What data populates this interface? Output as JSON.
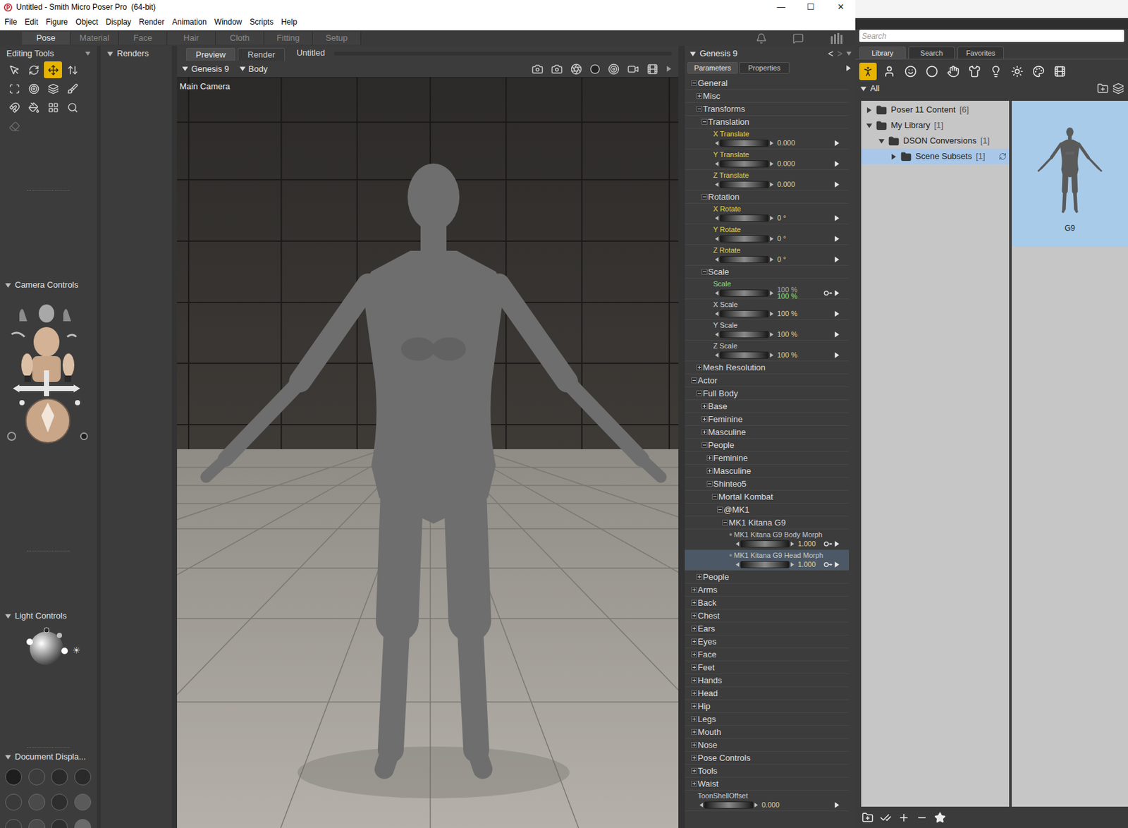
{
  "window": {
    "title": "Untitled - Smith Micro Poser Pro  (64-bit)",
    "controls": [
      "—",
      "☐",
      "✕"
    ]
  },
  "menu": [
    "File",
    "Edit",
    "Figure",
    "Object",
    "Display",
    "Render",
    "Animation",
    "Window",
    "Scripts",
    "Help"
  ],
  "rooms": [
    {
      "label": "Pose",
      "selected": true
    },
    {
      "label": "Material",
      "selected": false
    },
    {
      "label": "Face",
      "selected": false
    },
    {
      "label": "Hair",
      "selected": false
    },
    {
      "label": "Cloth",
      "selected": false
    },
    {
      "label": "Fitting",
      "selected": false
    },
    {
      "label": "Setup",
      "selected": false
    }
  ],
  "editing_tools": {
    "title": "Editing Tools",
    "tools": [
      {
        "selected": false,
        "disabled": false
      },
      {
        "selected": false,
        "disabled": false
      },
      {
        "selected": true,
        "disabled": false
      },
      {
        "selected": false,
        "disabled": false
      },
      {
        "selected": false,
        "disabled": false
      },
      {
        "selected": false,
        "disabled": false
      },
      {
        "selected": false,
        "disabled": false
      },
      {
        "selected": false,
        "disabled": false
      },
      {
        "selected": false,
        "disabled": false
      },
      {
        "selected": false,
        "disabled": false
      },
      {
        "selected": false,
        "disabled": false
      },
      {
        "selected": false,
        "disabled": false
      },
      {
        "selected": false,
        "disabled": true
      }
    ]
  },
  "camera_controls": {
    "title": "Camera Controls"
  },
  "light_controls": {
    "title": "Light Controls"
  },
  "document_display": {
    "title": "Document Displa..."
  },
  "renders": {
    "title": "Renders"
  },
  "viewport": {
    "tabs": [
      {
        "label": "Preview",
        "selected": true
      },
      {
        "label": "Render",
        "selected": false
      }
    ],
    "document": "Untitled",
    "figure": "Genesis 9",
    "actor": "Body",
    "camera": "Main Camera"
  },
  "parameters": {
    "figure": "Genesis 9",
    "nav": [
      "<",
      ">"
    ],
    "tabs": [
      {
        "label": "Parameters",
        "selected": true
      },
      {
        "label": "Properties",
        "selected": false
      }
    ],
    "rows": [
      {
        "kind": "group",
        "label": "General",
        "depth": 0,
        "expanded": true
      },
      {
        "kind": "group",
        "label": "Misc",
        "depth": 1,
        "expanded": false
      },
      {
        "kind": "group",
        "label": "Transforms",
        "depth": 1,
        "expanded": true
      },
      {
        "kind": "group",
        "label": "Translation",
        "depth": 2,
        "expanded": true
      },
      {
        "kind": "dial",
        "label": "X Translate",
        "depth": 3,
        "values": [
          "0.000"
        ],
        "color": "#e6d34a",
        "linked": false,
        "selected": false
      },
      {
        "kind": "dial",
        "label": "Y Translate",
        "depth": 3,
        "values": [
          "0.000"
        ],
        "color": "#e6d34a",
        "linked": false,
        "selected": false
      },
      {
        "kind": "dial",
        "label": "Z Translate",
        "depth": 3,
        "values": [
          "0.000"
        ],
        "color": "#e6d34a",
        "linked": false,
        "selected": false
      },
      {
        "kind": "group",
        "label": "Rotation",
        "depth": 2,
        "expanded": true
      },
      {
        "kind": "dial",
        "label": "X Rotate",
        "depth": 3,
        "values": [
          "0 °"
        ],
        "color": "#e6d34a",
        "linked": false,
        "selected": false
      },
      {
        "kind": "dial",
        "label": "Y Rotate",
        "depth": 3,
        "values": [
          "0 °"
        ],
        "color": "#e6d34a",
        "linked": false,
        "selected": false
      },
      {
        "kind": "dial",
        "label": "Z Rotate",
        "depth": 3,
        "values": [
          "0 °"
        ],
        "color": "#e6d34a",
        "linked": false,
        "selected": false
      },
      {
        "kind": "group",
        "label": "Scale",
        "depth": 2,
        "expanded": true
      },
      {
        "kind": "dial",
        "label": "Scale",
        "depth": 3,
        "values": [
          "100 %",
          "100 %"
        ],
        "color": "#8ee07a",
        "linked": true,
        "selected": false
      },
      {
        "kind": "dial",
        "label": "X Scale",
        "depth": 3,
        "values": [
          "100 %"
        ],
        "color": "#d8d8d8",
        "linked": false,
        "selected": false
      },
      {
        "kind": "dial",
        "label": "Y Scale",
        "depth": 3,
        "values": [
          "100 %"
        ],
        "color": "#d8d8d8",
        "linked": false,
        "selected": false
      },
      {
        "kind": "dial",
        "label": "Z Scale",
        "depth": 3,
        "values": [
          "100 %"
        ],
        "color": "#d8d8d8",
        "linked": false,
        "selected": false
      },
      {
        "kind": "group",
        "label": "Mesh Resolution",
        "depth": 1,
        "expanded": false
      },
      {
        "kind": "group",
        "label": "Actor",
        "depth": 0,
        "expanded": true
      },
      {
        "kind": "group",
        "label": "Full Body",
        "depth": 1,
        "expanded": true
      },
      {
        "kind": "group",
        "label": "Base",
        "depth": 2,
        "expanded": false
      },
      {
        "kind": "group",
        "label": "Feminine",
        "depth": 2,
        "expanded": false
      },
      {
        "kind": "group",
        "label": "Masculine",
        "depth": 2,
        "expanded": false
      },
      {
        "kind": "group",
        "label": "People",
        "depth": 2,
        "expanded": true
      },
      {
        "kind": "group",
        "label": "Feminine",
        "depth": 3,
        "expanded": false
      },
      {
        "kind": "group",
        "label": "Masculine",
        "depth": 3,
        "expanded": false
      },
      {
        "kind": "group",
        "label": "Shinteo5",
        "depth": 3,
        "expanded": true
      },
      {
        "kind": "group",
        "label": "Mortal Kombat",
        "depth": 4,
        "expanded": true
      },
      {
        "kind": "group",
        "label": "@MK1",
        "depth": 5,
        "expanded": true
      },
      {
        "kind": "group",
        "label": "MK1 Kitana G9",
        "depth": 6,
        "expanded": true
      },
      {
        "kind": "morph",
        "label": "MK1 Kitana G9 Body Morph",
        "depth": 7,
        "values": [
          "1.000"
        ],
        "color": "#c8c8c8",
        "linked": true,
        "selected": false
      },
      {
        "kind": "morph",
        "label": "MK1 Kitana G9 Head Morph",
        "depth": 7,
        "values": [
          "1.000"
        ],
        "color": "#c8c8c8",
        "linked": true,
        "selected": true
      },
      {
        "kind": "group",
        "label": "People",
        "depth": 1,
        "expanded": false
      },
      {
        "kind": "group",
        "label": "Arms",
        "depth": 0,
        "expanded": false
      },
      {
        "kind": "group",
        "label": "Back",
        "depth": 0,
        "expanded": false
      },
      {
        "kind": "group",
        "label": "Chest",
        "depth": 0,
        "expanded": false
      },
      {
        "kind": "group",
        "label": "Ears",
        "depth": 0,
        "expanded": false
      },
      {
        "kind": "group",
        "label": "Eyes",
        "depth": 0,
        "expanded": false
      },
      {
        "kind": "group",
        "label": "Face",
        "depth": 0,
        "expanded": false
      },
      {
        "kind": "group",
        "label": "Feet",
        "depth": 0,
        "expanded": false
      },
      {
        "kind": "group",
        "label": "Hands",
        "depth": 0,
        "expanded": false
      },
      {
        "kind": "group",
        "label": "Head",
        "depth": 0,
        "expanded": false
      },
      {
        "kind": "group",
        "label": "Hip",
        "depth": 0,
        "expanded": false
      },
      {
        "kind": "group",
        "label": "Legs",
        "depth": 0,
        "expanded": false
      },
      {
        "kind": "group",
        "label": "Mouth",
        "depth": 0,
        "expanded": false
      },
      {
        "kind": "group",
        "label": "Nose",
        "depth": 0,
        "expanded": false
      },
      {
        "kind": "group",
        "label": "Pose Controls",
        "depth": 0,
        "expanded": false
      },
      {
        "kind": "group",
        "label": "Tools",
        "depth": 0,
        "expanded": false
      },
      {
        "kind": "group",
        "label": "Waist",
        "depth": 0,
        "expanded": false
      },
      {
        "kind": "dial",
        "label": "ToonShellOffset",
        "depth": 0,
        "values": [
          "0.000"
        ],
        "color": "#d0d0d0",
        "linked": false,
        "selected": false
      }
    ]
  },
  "library": {
    "search": {
      "placeholder": "Search"
    },
    "tabs": [
      {
        "label": "Library",
        "selected": true
      },
      {
        "label": "Search",
        "selected": false
      },
      {
        "label": "Favorites",
        "selected": false
      }
    ],
    "categories": [
      {
        "selected": true
      },
      {
        "selected": false
      },
      {
        "selected": false
      },
      {
        "selected": false
      },
      {
        "selected": false
      },
      {
        "selected": false
      },
      {
        "selected": false
      },
      {
        "selected": false
      },
      {
        "selected": false
      },
      {
        "selected": false
      }
    ],
    "filter": "All",
    "tree": [
      {
        "label": "Poser 11 Content",
        "count": "[6]",
        "depth": 0,
        "expanded": false,
        "selected": false,
        "sync": false
      },
      {
        "label": "My Library",
        "count": "[1]",
        "depth": 0,
        "expanded": true,
        "selected": false,
        "sync": false
      },
      {
        "label": "DSON Conversions",
        "count": "[1]",
        "depth": 1,
        "expanded": true,
        "selected": false,
        "sync": false
      },
      {
        "label": "Scene Subsets",
        "count": "[1]",
        "depth": 2,
        "expanded": false,
        "selected": true,
        "sync": true
      }
    ],
    "items": [
      {
        "label": "G9",
        "selected": true
      }
    ]
  }
}
